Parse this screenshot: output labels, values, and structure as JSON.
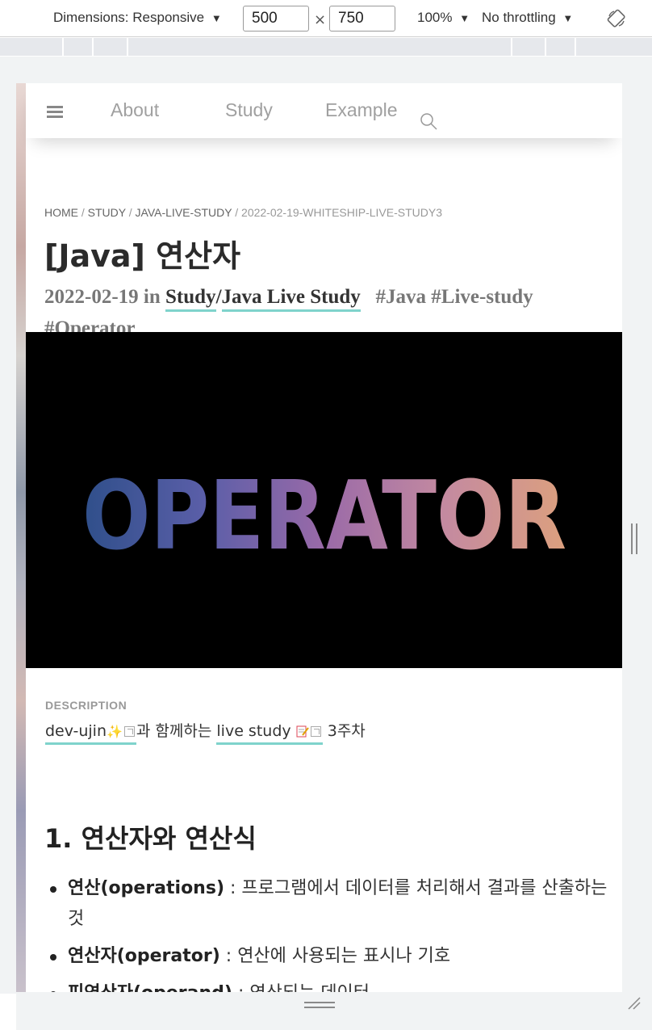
{
  "devtools": {
    "dimensions_label": "Dimensions: Responsive",
    "width_value": "500",
    "height_value": "750",
    "times": "×",
    "zoom": "100%",
    "throttling": "No throttling"
  },
  "nav": {
    "links": [
      "About",
      "Study",
      "Example"
    ]
  },
  "breadcrumb": {
    "items": [
      "HOME",
      "STUDY",
      "JAVA-LIVE-STUDY"
    ],
    "current": "2022-02-19-WHITESHIP-LIVE-STUDY3"
  },
  "post": {
    "title": "[Java] 연산자",
    "date": "2022-02-19",
    "in_word": "in",
    "category_1": "Study",
    "category_2": "Java Live Study",
    "tags": [
      "#Java",
      "#Live-study",
      "#Operator"
    ],
    "hero_text": "OPERATOR"
  },
  "description": {
    "label": "DESCRIPTION",
    "author_link": "dev-ujin",
    "connector": "과 함께하는",
    "study_link": "live study",
    "week": "3주차"
  },
  "section": {
    "heading": "1. 연산자와 연산식",
    "items": [
      {
        "term": "연산(operations)",
        "text": " : 프로그램에서 데이터를 처리해서 결과를 산출하는 것"
      },
      {
        "term": "연산자(operator)",
        "text": " : 연산에 사용되는 표시나 기호"
      },
      {
        "term": "피연산자(operand)",
        "text": " : 연산되는 데이터"
      }
    ]
  },
  "colors": {
    "accent_underline": "#7fd3cc",
    "hero_bg": "#000000",
    "nav_link": "#a0a0a0"
  }
}
